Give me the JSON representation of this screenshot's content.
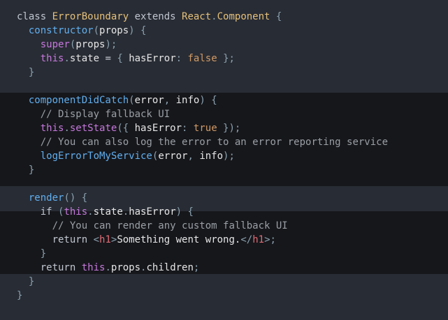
{
  "editor": {
    "language": "javascript",
    "colors": {
      "background": "#282c34",
      "highlight_band": "#16171b"
    },
    "lines": [
      [
        [
          "kw",
          "class "
        ],
        [
          "cls",
          "ErrorBoundary"
        ],
        [
          "kw",
          " extends "
        ],
        [
          "cls",
          "React"
        ],
        [
          "punc",
          "."
        ],
        [
          "cls",
          "Component"
        ],
        [
          "plain",
          " "
        ],
        [
          "punc",
          "{"
        ]
      ],
      [
        [
          "plain",
          "  "
        ],
        [
          "fn",
          "constructor"
        ],
        [
          "punc",
          "("
        ],
        [
          "var",
          "props"
        ],
        [
          "punc",
          ")"
        ],
        [
          "plain",
          " "
        ],
        [
          "punc",
          "{"
        ]
      ],
      [
        [
          "plain",
          "    "
        ],
        [
          "super",
          "super"
        ],
        [
          "punc",
          "("
        ],
        [
          "var",
          "props"
        ],
        [
          "punc",
          ");"
        ]
      ],
      [
        [
          "plain",
          "    "
        ],
        [
          "this",
          "this"
        ],
        [
          "punc",
          "."
        ],
        [
          "prop",
          "state"
        ],
        [
          "plain",
          " = "
        ],
        [
          "punc",
          "{ "
        ],
        [
          "key",
          "hasError"
        ],
        [
          "punc",
          ": "
        ],
        [
          "bool",
          "false"
        ],
        [
          "punc",
          " };"
        ]
      ],
      [
        [
          "plain",
          "  "
        ],
        [
          "punc",
          "}"
        ]
      ],
      [],
      [
        [
          "plain",
          "  "
        ],
        [
          "fn",
          "componentDidCatch"
        ],
        [
          "punc",
          "("
        ],
        [
          "var",
          "error"
        ],
        [
          "punc",
          ", "
        ],
        [
          "var",
          "info"
        ],
        [
          "punc",
          ")"
        ],
        [
          "plain",
          " "
        ],
        [
          "punc",
          "{"
        ]
      ],
      [
        [
          "plain",
          "    "
        ],
        [
          "comment",
          "// Display fallback UI"
        ]
      ],
      [
        [
          "plain",
          "    "
        ],
        [
          "this",
          "this"
        ],
        [
          "punc",
          "."
        ],
        [
          "method",
          "setState"
        ],
        [
          "punc",
          "({ "
        ],
        [
          "key",
          "hasError"
        ],
        [
          "punc",
          ": "
        ],
        [
          "bool",
          "true"
        ],
        [
          "punc",
          " });"
        ]
      ],
      [
        [
          "plain",
          "    "
        ],
        [
          "comment",
          "// You can also log the error to an error reporting service"
        ]
      ],
      [
        [
          "plain",
          "    "
        ],
        [
          "fn",
          "logErrorToMyService"
        ],
        [
          "punc",
          "("
        ],
        [
          "var",
          "error"
        ],
        [
          "punc",
          ", "
        ],
        [
          "var",
          "info"
        ],
        [
          "punc",
          ");"
        ]
      ],
      [
        [
          "plain",
          "  "
        ],
        [
          "punc",
          "}"
        ]
      ],
      [],
      [
        [
          "plain",
          "  "
        ],
        [
          "fn",
          "render"
        ],
        [
          "punc",
          "()"
        ],
        [
          "plain",
          " "
        ],
        [
          "punc",
          "{"
        ]
      ],
      [
        [
          "plain",
          "    "
        ],
        [
          "kw",
          "if"
        ],
        [
          "plain",
          " "
        ],
        [
          "punc",
          "("
        ],
        [
          "this",
          "this"
        ],
        [
          "punc",
          "."
        ],
        [
          "prop",
          "state"
        ],
        [
          "punc",
          "."
        ],
        [
          "prop",
          "hasError"
        ],
        [
          "punc",
          ")"
        ],
        [
          "plain",
          " "
        ],
        [
          "punc",
          "{"
        ]
      ],
      [
        [
          "plain",
          "      "
        ],
        [
          "comment",
          "// You can render any custom fallback UI"
        ]
      ],
      [
        [
          "plain",
          "      "
        ],
        [
          "kw",
          "return "
        ],
        [
          "punc",
          "<"
        ],
        [
          "tag",
          "h1"
        ],
        [
          "punc",
          ">"
        ],
        [
          "text",
          "Something went wrong."
        ],
        [
          "punc",
          "</"
        ],
        [
          "tag",
          "h1"
        ],
        [
          "punc",
          ">;"
        ]
      ],
      [
        [
          "plain",
          "    "
        ],
        [
          "punc",
          "}"
        ]
      ],
      [
        [
          "plain",
          "    "
        ],
        [
          "kw",
          "return "
        ],
        [
          "this",
          "this"
        ],
        [
          "punc",
          "."
        ],
        [
          "prop",
          "props"
        ],
        [
          "punc",
          "."
        ],
        [
          "prop",
          "children"
        ],
        [
          "punc",
          ";"
        ]
      ],
      [
        [
          "plain",
          "  "
        ],
        [
          "punc",
          "}"
        ]
      ],
      [
        [
          "punc",
          "}"
        ]
      ]
    ]
  }
}
